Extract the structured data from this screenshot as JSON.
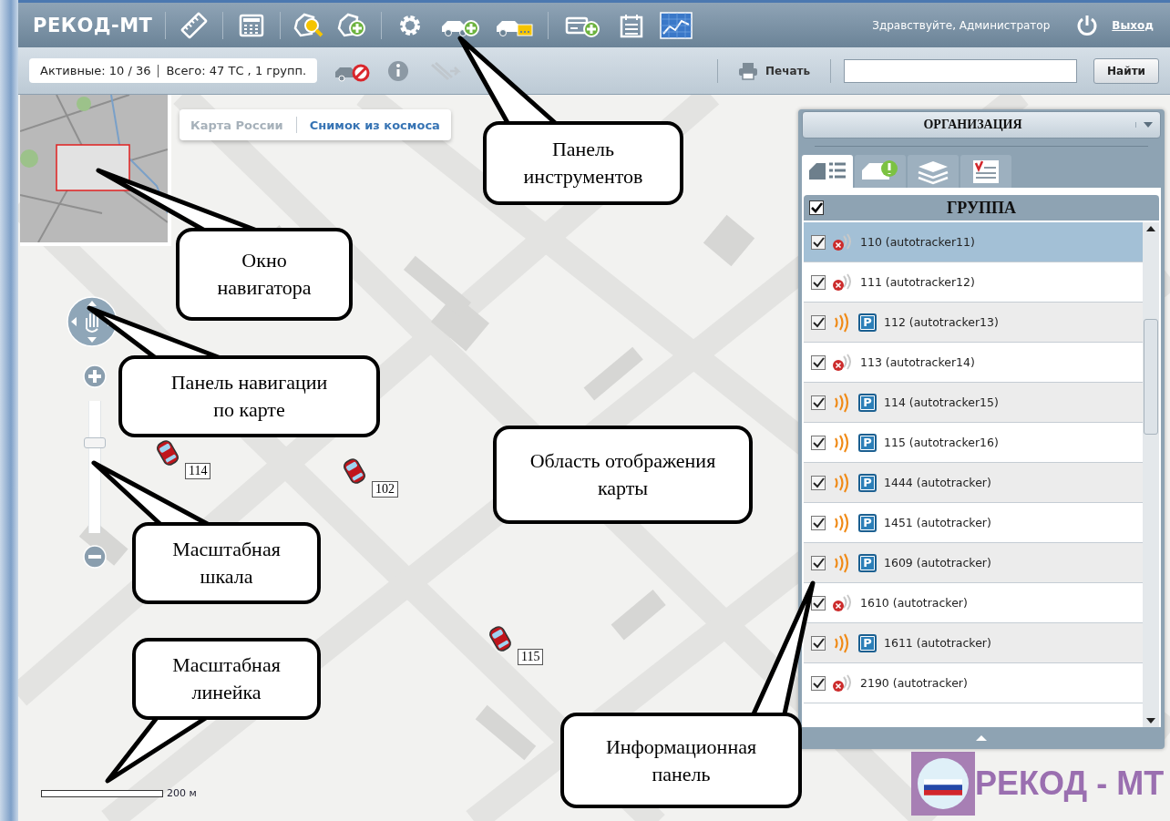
{
  "app": {
    "logo": "РЕКОД-МТ",
    "greeting": "Здравствуйте, Администратор",
    "logout": "Выход"
  },
  "toolbar": {
    "status_active": "Активные: 10 / 36",
    "status_total": "Всего: 47 ТС , 1 групп.",
    "print": "Печать",
    "search_button": "Найти"
  },
  "map": {
    "layers": [
      {
        "label": "Карта России",
        "selected": false
      },
      {
        "label": "Снимок из космоса",
        "selected": true
      }
    ],
    "zoom": {
      "level": 0.7
    },
    "scale": "200 м",
    "markers": [
      {
        "label": "114"
      },
      {
        "label": "102"
      },
      {
        "label": "115"
      }
    ],
    "logo": "РЕКОД - МТ"
  },
  "panel": {
    "title": "ОРГАНИЗАЦИЯ",
    "tabs": [
      {
        "kind": "vehicles",
        "selected": true
      },
      {
        "kind": "alerts",
        "selected": false
      },
      {
        "kind": "layers",
        "selected": false
      },
      {
        "kind": "reports",
        "selected": false
      }
    ],
    "group": {
      "label": "ГРУППА",
      "checked": true
    },
    "rows": [
      {
        "label": "110 (autotracker11)",
        "kind": "offline",
        "checked": true,
        "selected": true
      },
      {
        "label": "111 (autotracker12)",
        "kind": "offline",
        "checked": true,
        "selected": false
      },
      {
        "label": "112 (autotracker13)",
        "kind": "parking",
        "badge": "P",
        "checked": true,
        "selected": false
      },
      {
        "label": "113 (autotracker14)",
        "kind": "offline",
        "checked": true,
        "selected": false
      },
      {
        "label": "114 (autotracker15)",
        "kind": "parking",
        "badge": "P",
        "checked": true,
        "selected": false
      },
      {
        "label": "115 (autotracker16)",
        "kind": "parking",
        "badge": "P",
        "checked": true,
        "selected": false
      },
      {
        "label": "1444 (autotracker)",
        "kind": "parking",
        "badge": "P",
        "checked": true,
        "selected": false
      },
      {
        "label": "1451 (autotracker)",
        "kind": "parking",
        "badge": "P",
        "checked": true,
        "selected": false
      },
      {
        "label": "1609 (autotracker)",
        "kind": "parking",
        "badge": "P",
        "checked": true,
        "selected": false
      },
      {
        "label": "1610 (autotracker)",
        "kind": "offline",
        "checked": true,
        "selected": false
      },
      {
        "label": "1611 (autotracker)",
        "kind": "parking",
        "badge": "P",
        "checked": true,
        "selected": false
      },
      {
        "label": "2190 (autotracker)",
        "kind": "offline",
        "checked": true,
        "selected": false
      }
    ]
  },
  "callouts": [
    {
      "text": "Панель инструментов"
    },
    {
      "text": "Окно навигатора"
    },
    {
      "text": "Панель навигации по карте"
    },
    {
      "text": "Масштабная шкала"
    },
    {
      "text": "Масштабная линейка"
    },
    {
      "text": "Область отображения карты"
    },
    {
      "text": "Информационная панель"
    }
  ]
}
